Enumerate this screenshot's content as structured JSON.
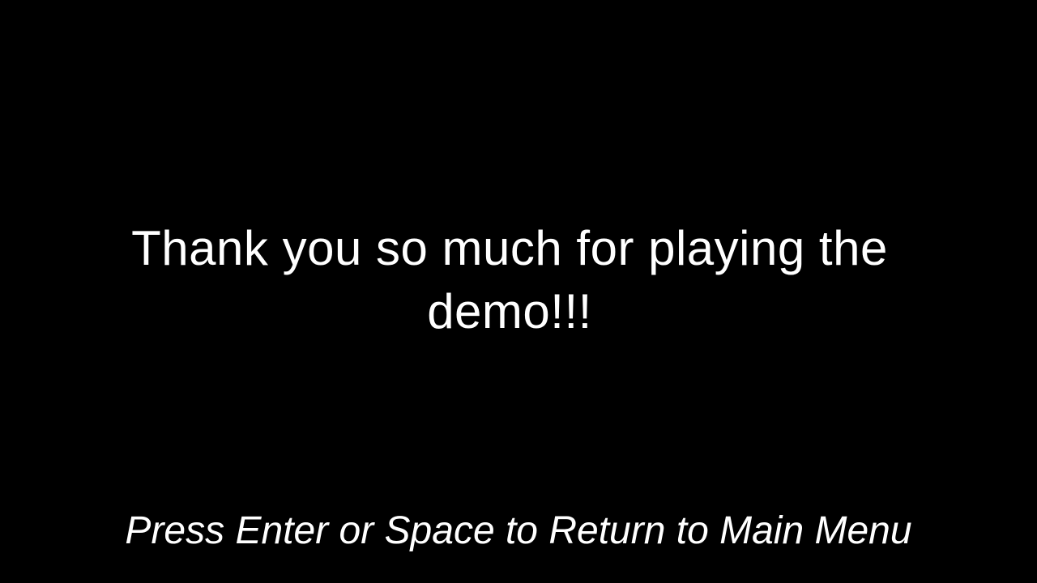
{
  "end_screen": {
    "message": "Thank you so much for playing the demo!!!",
    "prompt": "Press Enter or Space to Return to Main Menu"
  },
  "colors": {
    "background": "#000000",
    "text": "#ffffff"
  }
}
